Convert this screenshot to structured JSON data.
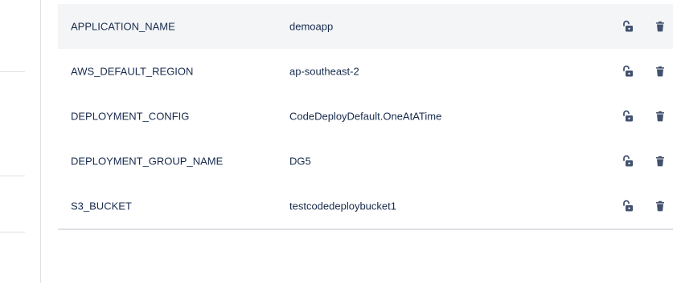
{
  "variables": [
    {
      "key": "APPLICATION_NAME",
      "value": "demoapp"
    },
    {
      "key": "AWS_DEFAULT_REGION",
      "value": "ap-southeast-2"
    },
    {
      "key": "DEPLOYMENT_CONFIG",
      "value": "CodeDeployDefault.OneAtATime"
    },
    {
      "key": "DEPLOYMENT_GROUP_NAME",
      "value": "DG5"
    },
    {
      "key": "S3_BUCKET",
      "value": "testcodedeploybucket1"
    }
  ],
  "icons": {
    "lock": "unlocked-padlock-icon",
    "delete": "trash-icon"
  },
  "colors": {
    "text": "#172b4d",
    "icon": "#42526e",
    "highlight_row": "#f4f5f7",
    "border": "#dfe1e6"
  }
}
